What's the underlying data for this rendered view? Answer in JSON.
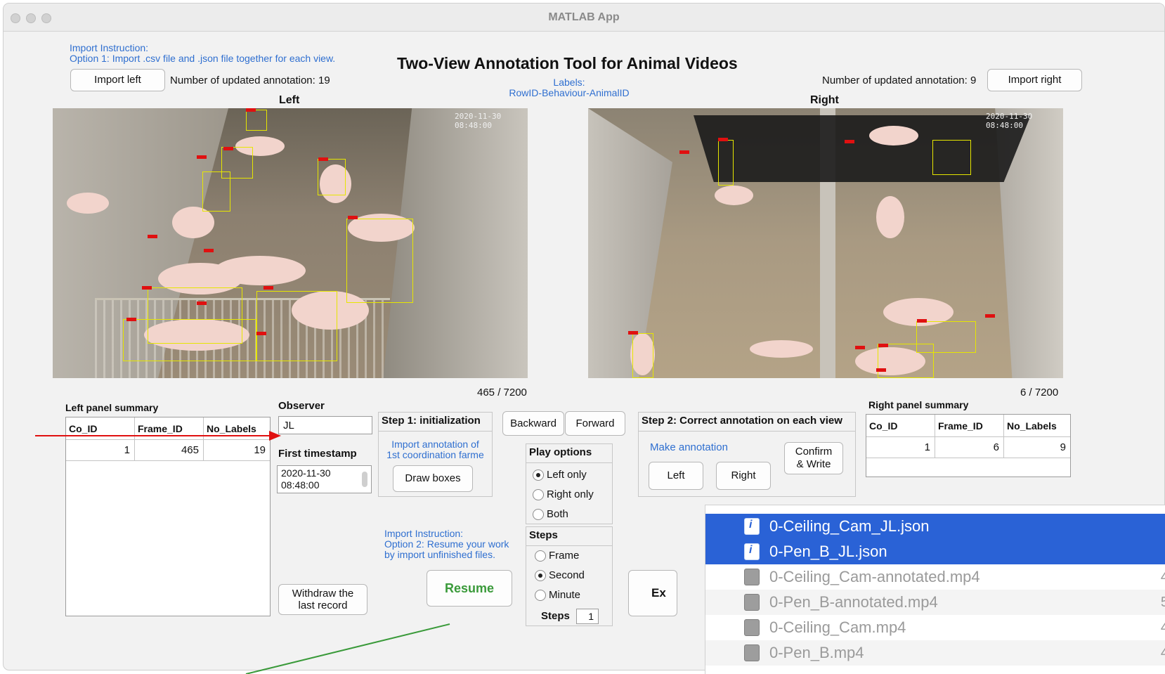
{
  "window": {
    "title": "MATLAB App"
  },
  "header": {
    "import_instruction_title": "Import Instruction:",
    "import_instruction_opt1": "Option 1: Import .csv file and .json file together for each view.",
    "app_title": "Two-View Annotation Tool for Animal Videos",
    "labels_title": "Labels:",
    "labels_format": "RowID-Behaviour-AnimalID",
    "import_left_label": "Import left",
    "import_right_label": "Import right",
    "left_updated": "Number of updated annotation: 19",
    "right_updated": "Number of updated annotation: 9",
    "left_view_label": "Left",
    "right_view_label": "Right"
  },
  "videos": {
    "left_timestamp": "2020-11-30 08:48:00",
    "right_timestamp": "2020-11-30 08:48:00",
    "left_counter": "465  /  7200",
    "right_counter": "6  /  7200"
  },
  "left_summary": {
    "title": "Left panel summary",
    "columns": [
      "Co_ID",
      "Frame_ID",
      "No_Labels"
    ],
    "rows": [
      [
        "1",
        "465",
        "19"
      ]
    ]
  },
  "right_summary": {
    "title": "Right panel summary",
    "columns": [
      "Co_ID",
      "Frame_ID",
      "No_Labels"
    ],
    "rows": [
      [
        "1",
        "6",
        "9"
      ]
    ]
  },
  "observer": {
    "label": "Observer",
    "value": "JL",
    "first_timestamp_label": "First timestamp",
    "first_timestamp_value_line1": "2020-11-30",
    "first_timestamp_value_line2": "08:48:00"
  },
  "step1": {
    "title": "Step 1: initialization",
    "hint_line1": "Import annotation of",
    "hint_line2": "1st coordination farme",
    "draw_boxes_label": "Draw boxes"
  },
  "nav": {
    "backward_label": "Backward",
    "forward_label": "Forward"
  },
  "play_options": {
    "title": "Play options",
    "options": [
      "Left only",
      "Right only",
      "Both"
    ],
    "selected": "Left only"
  },
  "steps": {
    "title": "Steps",
    "options": [
      "Frame",
      "Second",
      "Minute"
    ],
    "selected": "Second",
    "steps_label": "Steps",
    "steps_value": "1"
  },
  "step2": {
    "title": "Step 2: Correct annotation on each view",
    "make_annotation": "Make annotation",
    "confirm_line1": "Confirm",
    "confirm_line2": "& Write",
    "left_label": "Left",
    "right_label": "Right"
  },
  "resume_section": {
    "instruction_title": "Import Instruction:",
    "instruction_line1": "Option 2: Resume your work",
    "instruction_line2": "by import unfinished files.",
    "resume_label": "Resume",
    "withdraw_line1": "Withdraw the",
    "withdraw_line2": "last record",
    "export_partial": "Ex"
  },
  "file_picker": {
    "files": [
      {
        "name": "0-Ceiling_Cam_JL.json",
        "selected": true,
        "icon": "json-file-icon"
      },
      {
        "name": "0-Pen_B_JL.json",
        "selected": true,
        "icon": "json-file-icon"
      },
      {
        "name": "0-Ceiling_Cam-annotated.mp4",
        "selected": false,
        "icon": "video-file-icon",
        "size": "4"
      },
      {
        "name": "0-Pen_B-annotated.mp4",
        "selected": false,
        "icon": "video-file-icon",
        "size": "5"
      },
      {
        "name": "0-Ceiling_Cam.mp4",
        "selected": false,
        "icon": "video-file-icon",
        "size": "4"
      },
      {
        "name": "0-Pen_B.mp4",
        "selected": false,
        "icon": "video-file-icon",
        "size": "4"
      }
    ]
  },
  "colors": {
    "accent_blue": "#2f6fd0",
    "resume_green": "#3a9a3a",
    "selection_blue": "#2a62d6",
    "bbox_yellow": "#e6e600",
    "arrow_red": "#e01010",
    "arrow_green": "#3a9a3a"
  }
}
